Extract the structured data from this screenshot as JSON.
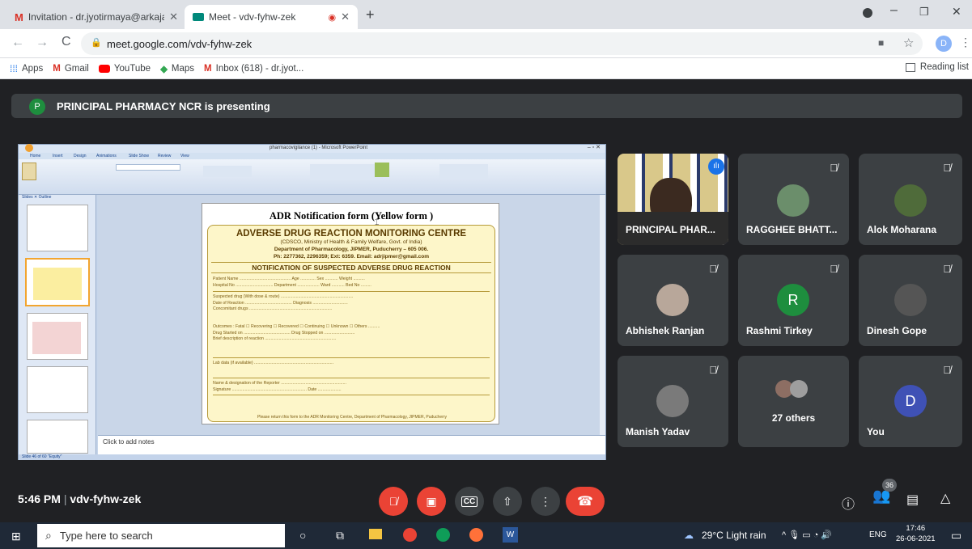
{
  "browser": {
    "tabs": [
      {
        "title": "Invitation - dr.jyotirmaya@arkaja",
        "active": false
      },
      {
        "title": "Meet - vdv-fyhw-zek",
        "active": true
      }
    ],
    "url": "meet.google.com/vdv-fyhw-zek",
    "bookmarks": [
      "Apps",
      "Gmail",
      "YouTube",
      "Maps",
      "Inbox (618) - dr.jyot..."
    ],
    "reading_list": "Reading list",
    "profile_letter": "D"
  },
  "meet": {
    "presenter_initial": "P",
    "presenting_text": "PRINCIPAL PHARMACY NCR is presenting",
    "time": "5:46 PM",
    "meeting_code": "vdv-fyhw-zek",
    "participant_count": "36",
    "participants": [
      {
        "name": "PRINCIPAL PHAR...",
        "muted": false
      },
      {
        "name": "RAGGHEE BHATT...",
        "muted": true
      },
      {
        "name": "Alok Moharana",
        "muted": true
      },
      {
        "name": "Abhishek Ranjan",
        "muted": true
      },
      {
        "name": "Rashmi Tirkey",
        "muted": true,
        "initial": "R"
      },
      {
        "name": "Dinesh Gope",
        "muted": true
      },
      {
        "name": "Manish Yadav",
        "muted": true
      },
      {
        "name": "27 others",
        "muted": false
      },
      {
        "name": "You",
        "muted": true,
        "initial": "D"
      }
    ]
  },
  "slide": {
    "window_title": "pharmacovigilance (1) - Microsoft PowerPoint",
    "ribbon_tabs": [
      "Home",
      "Insert",
      "Design",
      "Animations",
      "Slide Show",
      "Review",
      "View"
    ],
    "panel_tabs": [
      "Slides",
      "Outline"
    ],
    "heading": "ADR Notification form (Yellow form )",
    "centre_title": "ADVERSE DRUG REACTION MONITORING CENTRE",
    "centre_lines": [
      "(CDSCO, Ministry of Health & Family Welfare, Govt. of India)",
      "Department of Pharmacology, JIPMER, Puducherry – 605 006.",
      "Ph: 2277362, 2296359; Ext: 6359. Email: adrjipmer@gmail.com"
    ],
    "notification_title": "NOTIFICATION OF SUSPECTED ADVERSE DRUG REACTION",
    "form_rows": [
      "Patient Name ............................................ Age ............. Sex ........... Weight ..........",
      "Hospital No ................................ Department ................... Ward ........... Bed No .........",
      "Suspected drug (With dose & route) ..............................................................",
      "Date of Reaction ........................................ Diagnosis ..............................",
      "Concomitant drugs .......................................................................",
      "Outcomes : Fatal ☐ Recovering ☐ Recovered ☐ Continuing ☐ Unknown ☐ Others ..........",
      "Drug Started on ........................................ Drug Stopped on ..........................",
      "Brief description of reaction .............................................................",
      "Lab data (if available) ....................................................................",
      "Name & designation of the Reporter ........................................................",
      "Signature ................................................................ Date ...................."
    ],
    "footer_note": "Please return this form to the ADR Monitoring Centre, Department of Pharmacology, JIPMER, Puducherry",
    "notes_placeholder": "Click to add notes",
    "status_text": "Slide 46 of 60   \"Equity\""
  },
  "taskbar": {
    "search_placeholder": "Type here to search",
    "weather": "29°C  Light rain",
    "lang": "ENG",
    "clock_time": "17:46",
    "clock_date": "26-06-2021"
  },
  "colors": {
    "meet_bg": "#202124",
    "tile_bg": "#3c4043",
    "red": "#ea4335",
    "form_yellow": "#fdf6c9",
    "rashmi_avatar": "#1e8e3e",
    "you_avatar": "#3f51b5"
  }
}
